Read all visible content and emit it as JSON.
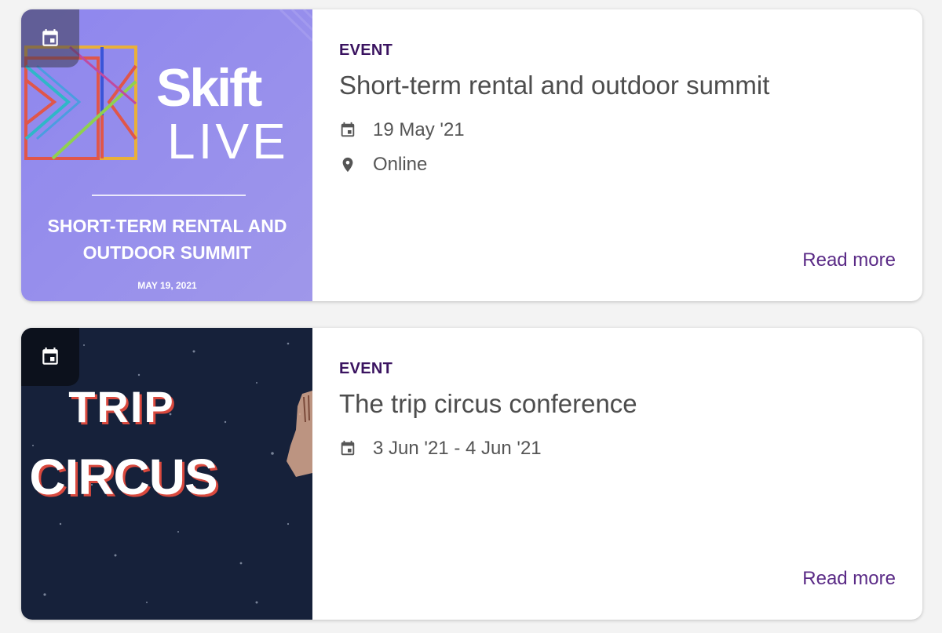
{
  "events": [
    {
      "type_label": "EVENT",
      "title": "Short-term rental and outdoor summit",
      "date": "19 May '21",
      "location": "Online",
      "read_more": "Read more",
      "image": {
        "brand_line1": "Skift",
        "brand_line2": "LIVE",
        "headline_line1": "SHORT-TERM RENTAL AND",
        "headline_line2": "OUTDOOR SUMMIT",
        "date": "MAY 19, 2021"
      }
    },
    {
      "type_label": "EVENT",
      "title": "The trip circus conference",
      "date": "3 Jun '21 - 4 Jun '21",
      "read_more": "Read more",
      "image": {
        "line1": "TRIP",
        "line2": "CIRCUS"
      }
    }
  ],
  "colors": {
    "accent": "#5a2a86",
    "eyebrow": "#3a1360",
    "text": "#4d4d4d",
    "background": "#f3f3f3"
  }
}
